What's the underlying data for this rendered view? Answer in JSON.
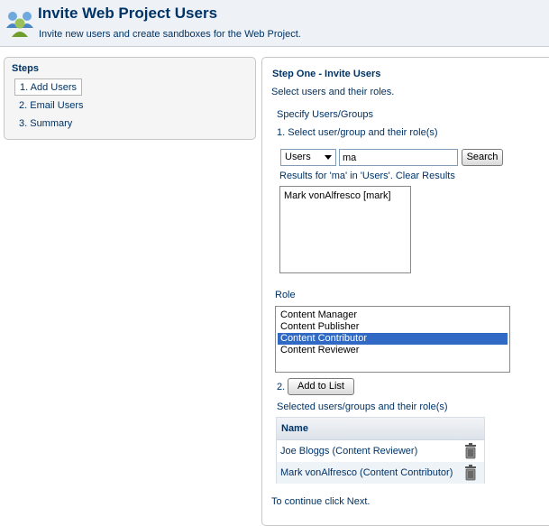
{
  "header": {
    "title": "Invite Web Project Users",
    "subtitle": "Invite new users and create sandboxes for the Web Project.",
    "icon": "users-group-icon"
  },
  "steps": {
    "title": "Steps",
    "items": [
      {
        "label": "1. Add Users",
        "active": true
      },
      {
        "label": "2. Email Users",
        "active": false
      },
      {
        "label": "3. Summary",
        "active": false
      }
    ]
  },
  "main": {
    "title": "Step One - Invite Users",
    "description": "Select users and their roles.",
    "specify_label": "Specify Users/Groups",
    "step1_label": "1. Select user/group and their role(s)",
    "type_select": {
      "value": "Users",
      "options": [
        "Users"
      ]
    },
    "search_input": {
      "value": "ma"
    },
    "search_button": "Search",
    "results_text": "Results for 'ma' in 'Users'.",
    "clear_results": "Clear Results",
    "results": [
      "Mark vonAlfresco [mark]"
    ],
    "role_label": "Role",
    "roles": [
      {
        "label": "Content Manager",
        "selected": false
      },
      {
        "label": "Content Publisher",
        "selected": false
      },
      {
        "label": "Content Contributor",
        "selected": true
      },
      {
        "label": "Content Reviewer",
        "selected": false
      }
    ],
    "step2_number": "2.",
    "add_button": "Add to List",
    "selected_label": "Selected users/groups and their role(s)",
    "table": {
      "header": "Name",
      "rows": [
        {
          "name": "Joe Bloggs (Content Reviewer)"
        },
        {
          "name": "Mark vonAlfresco (Content Contributor)"
        }
      ]
    },
    "continue_text": "To continue click Next."
  },
  "colors": {
    "brand": "#003366",
    "selection": "#316ac5",
    "header_bg": "#eef2f7"
  }
}
